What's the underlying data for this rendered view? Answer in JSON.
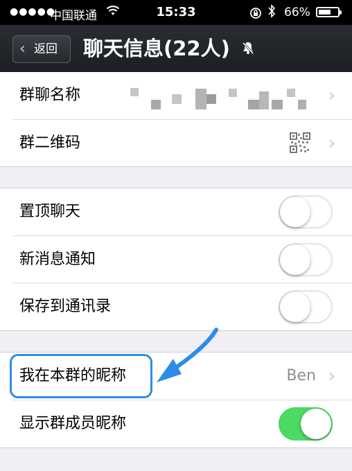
{
  "status_bar": {
    "carrier": "中国联通",
    "time": "15:33",
    "battery": "66%",
    "battery_level": 0.66
  },
  "nav": {
    "back_label": "返回",
    "title": "聊天信息(22人)"
  },
  "rows": {
    "group_name": {
      "label": "群聊名称"
    },
    "qr_code": {
      "label": "群二维码"
    },
    "pin_chat": {
      "label": "置顶聊天",
      "on": false
    },
    "notify": {
      "label": "新消息通知",
      "on": false
    },
    "save_contacts": {
      "label": "保存到通讯录",
      "on": false
    },
    "my_nickname": {
      "label": "我在本群的昵称",
      "value": "Ben"
    },
    "show_nicknames": {
      "label": "显示群成员昵称",
      "on": true
    }
  },
  "colors": {
    "toggle_on": "#4cd964",
    "highlight": "#2e8be8"
  }
}
